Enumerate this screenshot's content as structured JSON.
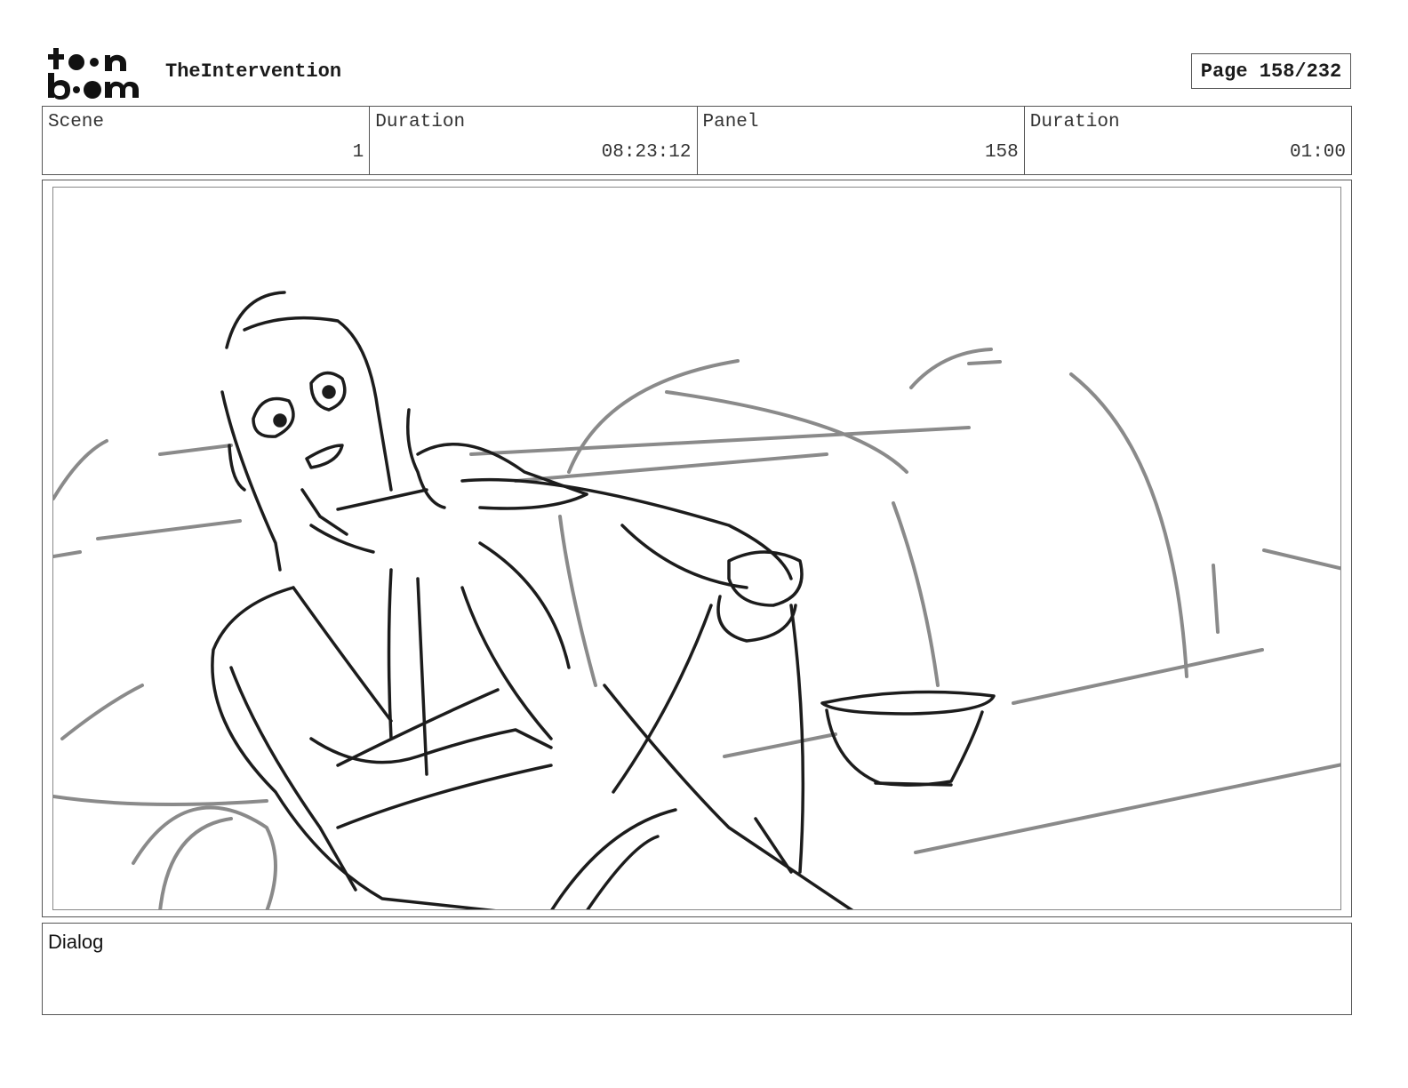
{
  "header": {
    "logo_icon": "toonboom-logo",
    "project_title": "TheIntervention",
    "page_label": "Page 158/232"
  },
  "info": {
    "scene_label": "Scene",
    "scene_value": "1",
    "scene_duration_label": "Duration",
    "scene_duration_value": "08:23:12",
    "panel_label": "Panel",
    "panel_value": "158",
    "panel_duration_label": "Duration",
    "panel_duration_value": "01:00"
  },
  "panel": {
    "image_icon": "storyboard-sketch"
  },
  "dialog": {
    "label": "Dialog"
  }
}
